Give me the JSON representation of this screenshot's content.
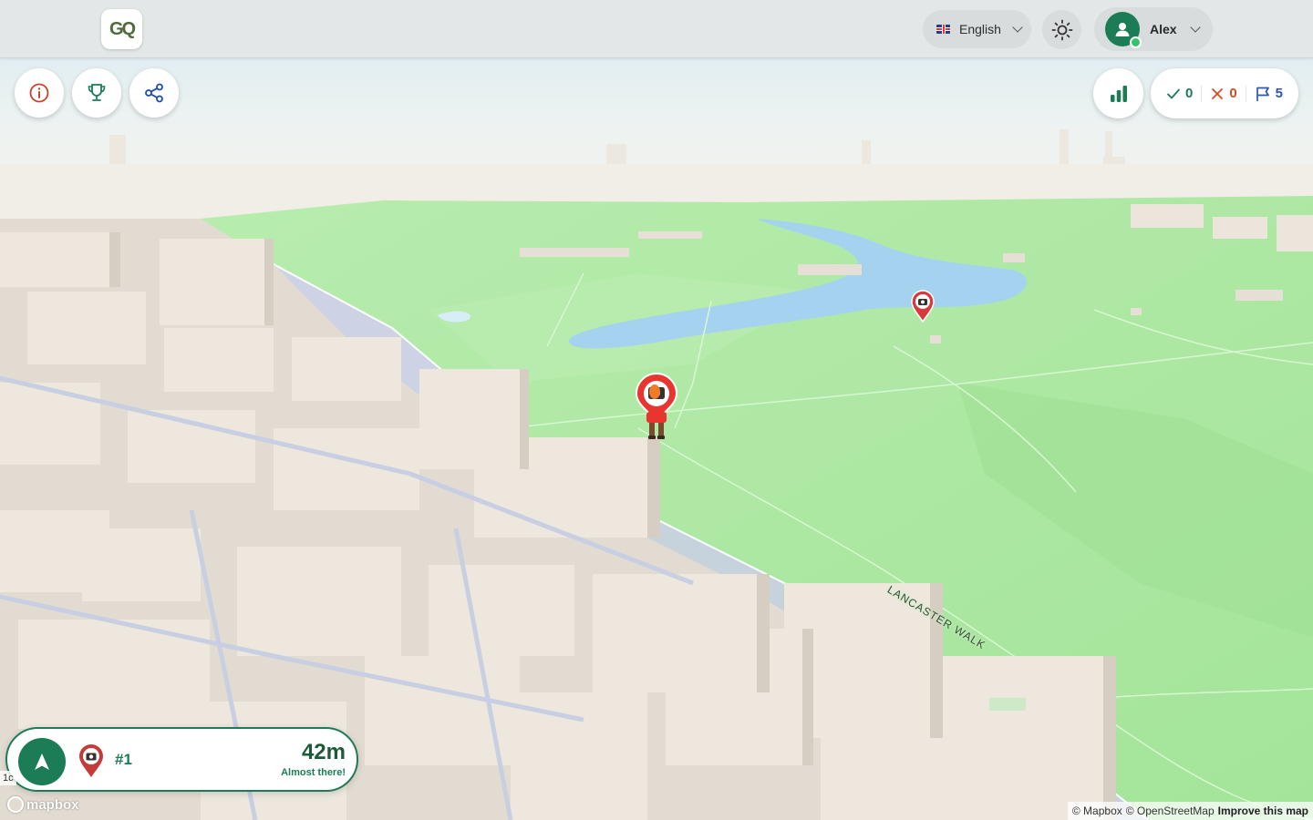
{
  "header": {
    "logo_text": "GQ",
    "language": {
      "label": "English",
      "flag": "uk-flag-icon"
    },
    "theme_icon": "sun-icon",
    "user": {
      "name": "Alex",
      "online": true
    }
  },
  "tools": [
    {
      "name": "info-icon"
    },
    {
      "name": "trophy-icon"
    },
    {
      "name": "share-icon"
    }
  ],
  "stats": {
    "icon": "bar-chart-icon",
    "correct": "0",
    "wrong": "0",
    "flags": "5"
  },
  "map": {
    "street_label": "LANCASTER WALK",
    "pins": [
      {
        "id": "target",
        "icon": "camera-icon",
        "color": "#d63a3a"
      },
      {
        "id": "player",
        "icon": "avatar-icon",
        "color": "#e8352f"
      }
    ]
  },
  "target_bar": {
    "rank": "#1",
    "distance": "42m",
    "status": "Almost there!"
  },
  "footer": {
    "scale": "1c",
    "mapbox_logo": "mapbox",
    "attribution": {
      "mapbox": "© Mapbox",
      "osm": "© OpenStreetMap",
      "improve": "Improve this map"
    }
  },
  "colors": {
    "brand": "#1b7c55",
    "park": "#a8e6a0",
    "water": "#a5d3ef",
    "building": "#e8e1d8",
    "pin": "#d63a3a"
  }
}
